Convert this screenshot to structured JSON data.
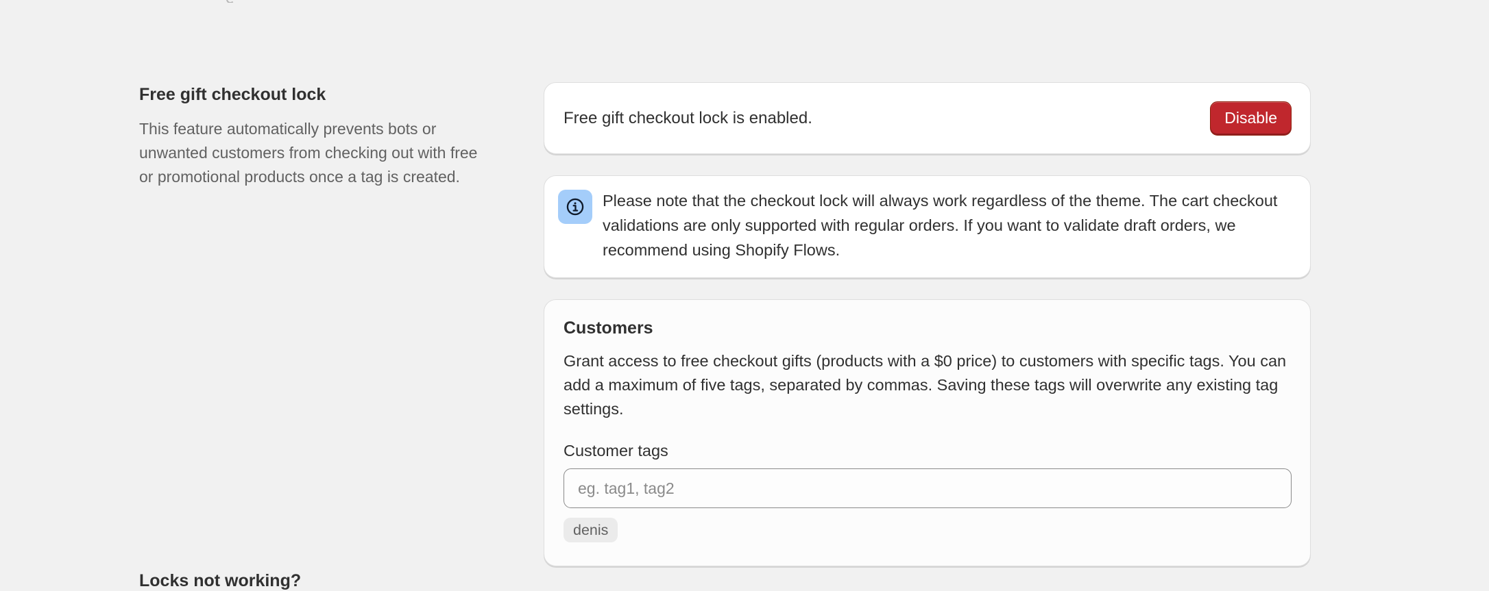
{
  "section": {
    "title": "Free gift checkout lock",
    "description": "This feature automatically prevents bots or unwanted customers from checking out with free or promotional products once a tag is created."
  },
  "status_card": {
    "text": "Free gift checkout lock is enabled.",
    "button_label": "Disable",
    "button_color": "#c0272d"
  },
  "info_banner": {
    "icon": "info-icon",
    "icon_bg": "#a4cdfa",
    "text": "Please note that the checkout lock will always work regardless of the theme. The cart checkout validations are only supported with regular orders. If you want to validate draft orders, we recommend using Shopify Flows."
  },
  "customers_card": {
    "title": "Customers",
    "description": "Grant access to free checkout gifts (products with a $0 price) to customers with specific tags. You can add a maximum of five tags, separated by commas. Saving these tags will overwrite any existing tag settings.",
    "field_label": "Customer tags",
    "input_value": "",
    "input_placeholder": "eg. tag1, tag2",
    "tags": [
      "denis"
    ]
  },
  "next_section": {
    "title": "Locks not working?"
  }
}
